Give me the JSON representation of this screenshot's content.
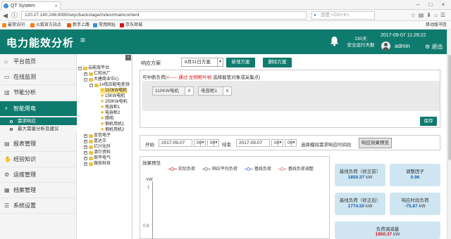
{
  "browser": {
    "tab_title": "QT System",
    "url": "120.27.140.246:8080/wqc/backstage/index#maincontent",
    "search_placeholder": "百度 <Ctrl+K>",
    "bookmarks": [
      {
        "label": "最常访问",
        "color": "#f08a24"
      },
      {
        "label": "火狐官方站点",
        "color": "#ff7b12"
      },
      {
        "label": "新手上路",
        "color": "#e55b13"
      },
      {
        "label": "常用网址",
        "color": "#3a8fd8"
      },
      {
        "label": "京东商城",
        "color": "#d21414"
      }
    ],
    "mobile_bookmarks": "移动版书签"
  },
  "header": {
    "brand": "电力能效分析",
    "menu_icon": "≡",
    "safe_days_value": "230天",
    "safe_days_label": "安全运行天数",
    "datetime": "2017-09-07 11:29:22",
    "username": "admin",
    "logout": "退出"
  },
  "sidebar": {
    "items": [
      {
        "label": "平台首页",
        "icon": "home-icon",
        "glyph": "⌂"
      },
      {
        "label": "在线监测",
        "icon": "monitor-icon",
        "glyph": "▭"
      },
      {
        "label": "节能分析",
        "icon": "chart-icon",
        "glyph": "▥"
      },
      {
        "label": "智能用电",
        "icon": "plug-icon",
        "glyph": "⚡"
      },
      {
        "label": "报表管理",
        "icon": "report-icon",
        "glyph": "▤"
      },
      {
        "label": "经验知识",
        "icon": "handshake-icon",
        "glyph": "✋"
      },
      {
        "label": "运维管理",
        "icon": "gear-icon",
        "glyph": "⚙"
      },
      {
        "label": "档案管理",
        "icon": "archive-icon",
        "glyph": "▦"
      },
      {
        "label": "系统设置",
        "icon": "list-icon",
        "glyph": "☰"
      }
    ],
    "subitems": [
      {
        "label": "需求响应"
      },
      {
        "label": "最大需量分析及建议"
      }
    ]
  },
  "tree": {
    "nodes": [
      {
        "label": "云能效平台"
      },
      {
        "label": "仁和水厂"
      },
      {
        "label": "大唐商业中心"
      },
      {
        "label": "1#低压配电室测"
      },
      {
        "label": "110KW电机"
      },
      {
        "label": "15KW电机"
      },
      {
        "label": "250KW电机"
      },
      {
        "label": "电容柜1"
      },
      {
        "label": "电容柜2"
      },
      {
        "label": "照明"
      },
      {
        "label": "钢机用机1"
      },
      {
        "label": "钢机用机2"
      },
      {
        "label": "金信电子"
      },
      {
        "label": "蓝达王"
      },
      {
        "label": "亿兴化纤"
      },
      {
        "label": "滇尔资料"
      },
      {
        "label": "商平电气"
      },
      {
        "label": "微技科技"
      }
    ]
  },
  "main": {
    "response_label": "响应方案",
    "plan_value": "8月31日方案",
    "add_plan": "新增方案",
    "delete_plan": "删除方案",
    "hint_prefix": "可中断负荷(",
    "hint_red": "<----- 通过 左侧柜叶树",
    "hint_suffix": " 选择能管对象或采集点)",
    "chips": [
      {
        "label": "110KW电机"
      },
      {
        "label": "电容柜1"
      }
    ],
    "chip_remove": "X",
    "save": "保存",
    "start_label": "开始",
    "start_date": "2017-09-07",
    "start_hour": "00",
    "start_min": "00",
    "end_label": "结束",
    "end_date": "2017-09-07",
    "end_hour": "00",
    "end_min": "00",
    "mode_label": "选择模拟需求响应时间段",
    "preview_btn": "响应效果预览"
  },
  "chart": {
    "title": "效果预览",
    "legend": [
      {
        "label": "实际负荷",
        "color": "#e05a5a"
      },
      {
        "label": "响应平均负荷",
        "color": "#888888"
      },
      {
        "label": "基线负荷",
        "color": "#6a8fcf"
      },
      {
        "label": "基线负荷调整",
        "color": "#e88a8a"
      }
    ],
    "unit": "kW",
    "y_ticks": [
      "1",
      "0.8"
    ]
  },
  "cards": [
    {
      "title": "基线负荷（修正前）",
      "value": "1850.37",
      "unit": "kW",
      "red": false
    },
    {
      "title": "调整因子",
      "value": "0.96",
      "unit": "",
      "red": false
    },
    {
      "title": "基线负荷（修正后）",
      "value": "1774.50",
      "unit": "kW",
      "red": false
    },
    {
      "title": "响应时段负荷",
      "value": "-75.87",
      "unit": "kW",
      "red": false
    },
    {
      "title": "负荷调减量",
      "value": "1850.37",
      "unit": "kW",
      "red": true
    }
  ],
  "colors": {
    "accent": "#0f7b6e",
    "highlight_red": "#d21414",
    "card_bg": "#cfe6f2"
  }
}
